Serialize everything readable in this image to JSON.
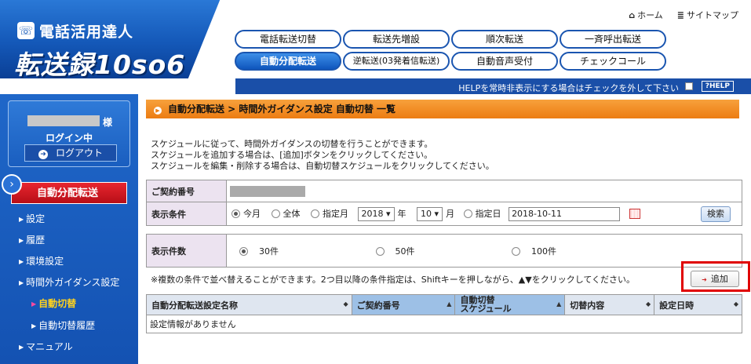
{
  "header": {
    "logo_icon": "phone-icon",
    "logo_top": "電話活用達人",
    "logo_main": "転送録10so6",
    "home_label": "ホーム",
    "sitemap_label": "サイトマップ"
  },
  "nav": {
    "items": [
      {
        "label": "電話転送切替"
      },
      {
        "label": "転送先増設"
      },
      {
        "label": "順次転送"
      },
      {
        "label": "一斉呼出転送"
      },
      {
        "label": "自動分配転送"
      },
      {
        "label": "逆転送(03発着信転送)"
      },
      {
        "label": "自動音声受付"
      },
      {
        "label": "チェックコール"
      }
    ]
  },
  "helpbar": {
    "text": "HELPを常時非表示にする場合はチェックを外して下さい",
    "help_button": "?HELP"
  },
  "sidebar": {
    "user_suffix": "様",
    "login_status": "ログイン中",
    "logout_label": "ログアウト",
    "section_title": "自動分配転送",
    "items": [
      {
        "label": "設定"
      },
      {
        "label": "履歴"
      },
      {
        "label": "環境設定"
      },
      {
        "label": "時間外ガイダンス設定"
      },
      {
        "label": "自動切替"
      },
      {
        "label": "自動切替履歴"
      },
      {
        "label": "マニュアル"
      }
    ]
  },
  "main": {
    "breadcrumb": "自動分配転送 > 時間外ガイダンス設定 自動切替 一覧",
    "desc": [
      "スケジュールに従って、時間外ガイダンスの切替を行うことができます。",
      "スケジュールを追加する場合は、[追加]ボタンをクリックしてください。",
      "スケジュールを編集・削除する場合は、自動切替スケジュールをクリックしてください。"
    ],
    "contract_label": "ご契約番号",
    "cond_label": "表示条件",
    "cond_today": "今月",
    "cond_all": "全体",
    "cond_month": "指定月",
    "year_value": "2018",
    "year_unit": "年",
    "month_value": "10",
    "month_unit": "月",
    "cond_day": "指定日",
    "date_value": "2018-10-11",
    "search_label": "検索",
    "count_label": "表示件数",
    "count_30": "30件",
    "count_50": "50件",
    "count_100": "100件",
    "note": "※複数の条件で並べ替えることができます。2つ目以降の条件指定は、Shiftキーを押しながら、▲▼をクリックしてください。",
    "add_label": "追加",
    "columns": [
      {
        "label": "自動分配転送設定名称",
        "sort": "◆"
      },
      {
        "label": "ご契約番号",
        "sort": "▲"
      },
      {
        "label1": "自動切替",
        "label2": "スケジュール",
        "sort": "▲"
      },
      {
        "label": "切替内容",
        "sort": "◆"
      },
      {
        "label": "設定日時",
        "sort": "◆"
      }
    ],
    "empty_text": "設定情報がありません"
  }
}
